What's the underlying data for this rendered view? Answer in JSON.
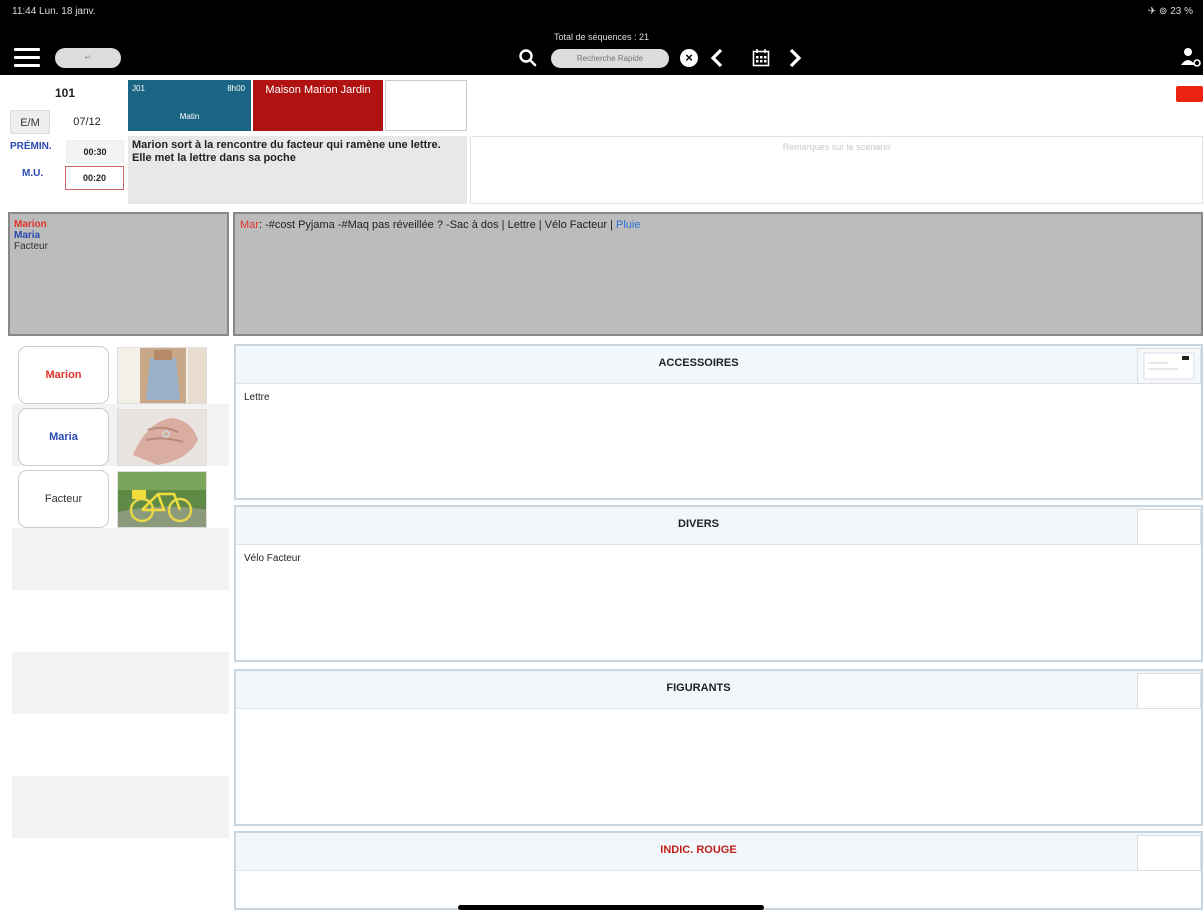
{
  "status": {
    "time": "11:44  Lun. 18 janv.",
    "right": "✈ ⊚ 23 %"
  },
  "toolbar": {
    "total_sequences": "Total de séquences : 21",
    "menu_pill": "↵",
    "search_placeholder": "Recherche Rapide"
  },
  "sequence": {
    "number": "101",
    "em_label": "E/M",
    "date": "07/12",
    "day": "J01",
    "time": "8h00",
    "period": "Matin",
    "location": "Maison Marion Jardin",
    "premin_label": "PRÉMIN.",
    "premin_value": "00:30",
    "mu_label": "M.U.",
    "mu_value": "00:20",
    "description": "Marion sort à la rencontre du facteur qui ramène une lettre. Elle met la lettre dans sa poche",
    "remarks_placeholder": "Remarques sur le scénario"
  },
  "cast_summary": [
    {
      "name": "Marion",
      "color": "#e0332a"
    },
    {
      "name": "Maria",
      "color": "#2a4ab3"
    },
    {
      "name": "Facteur",
      "color": "#333333"
    }
  ],
  "notes": {
    "prefix": "Mar",
    "text": ": -#cost Pyjama -#Maq pas réveillée ? -Sac à dos | Lettre | Vélo Facteur | ",
    "highlight": "Pluie"
  },
  "characters": [
    {
      "name": "Marion",
      "color": "#e0332a",
      "photo": "dress-photo"
    },
    {
      "name": "Maria",
      "color": "#2a4ab3",
      "photo": "hand-photo"
    },
    {
      "name": "Facteur",
      "color": "#333333",
      "photo": "bicycle-photo"
    }
  ],
  "sections": [
    {
      "title": "ACCESSOIRES",
      "content": "Lettre",
      "color": "#222222"
    },
    {
      "title": "DIVERS",
      "content": "Vélo Facteur",
      "color": "#222222"
    },
    {
      "title": "FIGURANTS",
      "content": "",
      "color": "#222222"
    },
    {
      "title": "INDIC. ROUGE",
      "content": "",
      "color": "#c0201a"
    }
  ],
  "colors": {
    "top_bar": "#000000",
    "day_box": "#1a6583",
    "location_box": "#b01212",
    "grey_band": "#bcbcbc"
  }
}
